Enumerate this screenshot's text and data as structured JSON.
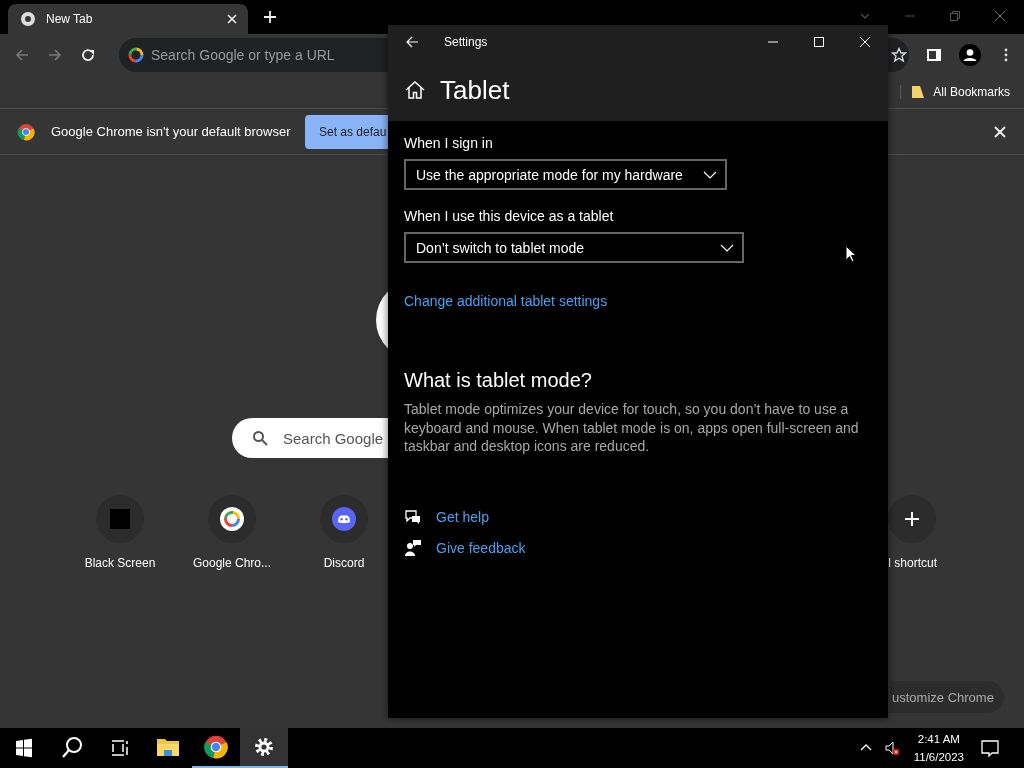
{
  "browser": {
    "tabs": [
      {
        "title": "New Tab",
        "selected": true
      }
    ],
    "omnibox": {
      "placeholder": "Search Google or type a URL"
    },
    "bookmarks": [
      {
        "label": "All Bookmarks"
      }
    ],
    "infobar": {
      "message": "Google Chrome isn't your default browser",
      "button": "Set as defau"
    },
    "new_tab_page": {
      "search": {
        "placeholder": "Search Google"
      },
      "shortcuts": [
        {
          "label": "Black Screen",
          "kind": "black"
        },
        {
          "label": "Google Chro...",
          "kind": "google"
        },
        {
          "label": "Discord",
          "kind": "discord"
        }
      ],
      "add_shortcut": {
        "label": "l shortcut"
      },
      "customize_button": "ustomize Chrome"
    }
  },
  "settings": {
    "window_title": "Settings",
    "page_title": "Tablet",
    "fields": [
      {
        "label": "When I sign in",
        "value": "Use the appropriate mode for my hardware"
      },
      {
        "label": "When I use this device as a tablet",
        "value": "Don’t switch to tablet mode"
      }
    ],
    "link": "Change additional tablet settings",
    "section_title": "What is tablet mode?",
    "description": "Tablet mode optimizes your device for touch, so you don’t have to use a keyboard and mouse. When tablet mode is on, apps open full-screen and taskbar and desktop icons are reduced.",
    "help_links": [
      {
        "label": "Get help",
        "kind": "help"
      },
      {
        "label": "Give feedback",
        "kind": "feedback"
      }
    ]
  },
  "taskbar": {
    "apps": [
      {
        "kind": "explorer",
        "selected": false
      },
      {
        "kind": "chrome",
        "selected": false
      },
      {
        "kind": "settings",
        "selected": true
      }
    ],
    "time": "2:41 AM",
    "date": "11/6/2023"
  }
}
